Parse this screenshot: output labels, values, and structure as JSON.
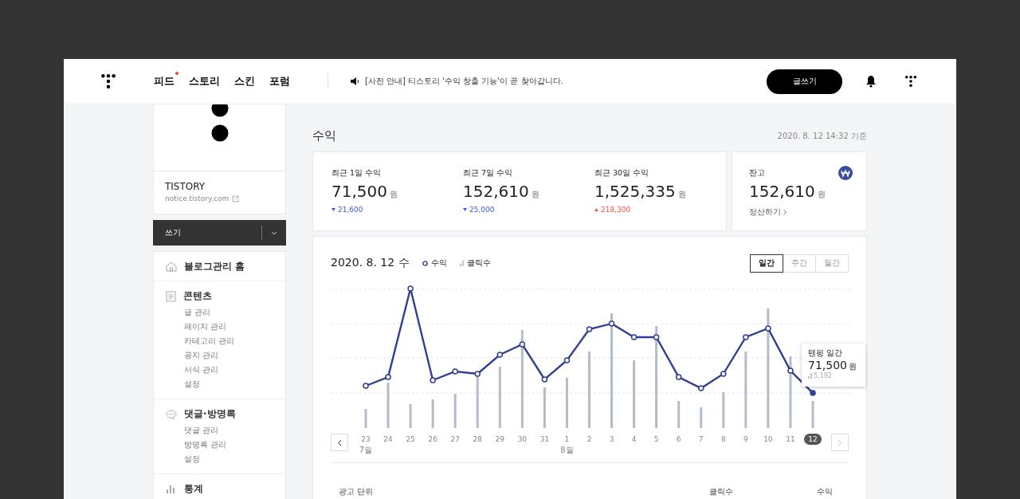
{
  "header": {
    "nav": [
      {
        "label": "피드",
        "new": true
      },
      {
        "label": "스토리",
        "new": false
      },
      {
        "label": "스킨",
        "new": false
      },
      {
        "label": "포럼",
        "new": false
      }
    ],
    "notice": "[사전 안내] 티스토리 '수익 창출 기능'이 곧 찾아갑니다.",
    "write_button": "글쓰기"
  },
  "sidebar": {
    "blog_name": "TISTORY",
    "blog_url": "notice.tistory.com",
    "write": "쓰기",
    "menu": [
      {
        "kind": "home",
        "label": "블로그관리 홈"
      },
      {
        "kind": "document",
        "label": "콘텐츠",
        "children": [
          {
            "label": "글 관리"
          },
          {
            "label": "페이지 관리"
          },
          {
            "label": "카테고리 관리"
          },
          {
            "label": "공지 관리"
          },
          {
            "label": "서식 관리"
          },
          {
            "label": "설정"
          }
        ]
      },
      {
        "kind": "comment",
        "label": "댓글·방명록",
        "children": [
          {
            "label": "댓글 관리"
          },
          {
            "label": "방명록 관리"
          },
          {
            "label": "설정"
          }
        ]
      },
      {
        "kind": "stats",
        "label": "통계"
      }
    ]
  },
  "main": {
    "title": "수익",
    "timestamp": "2020. 8. 12 14:32 기준",
    "stats": [
      {
        "label": "최근 1일 수익",
        "value": "71,500",
        "unit": "원",
        "kind": "down",
        "change": "21,600"
      },
      {
        "label": "최근 7일 수익",
        "value": "152,610",
        "unit": "원",
        "kind": "down",
        "change": "25,000"
      },
      {
        "label": "최근 30일 수익",
        "value": "1,525,335",
        "unit": "원",
        "kind": "up",
        "change": "218,300"
      }
    ],
    "balance": {
      "label": "잔고",
      "value": "152,610",
      "unit": "원",
      "link": "정산하기"
    },
    "chart": {
      "title": "2020. 8. 12 수",
      "legend": [
        {
          "kind": "line",
          "label": "수익"
        },
        {
          "kind": "bar",
          "label": "클릭수"
        }
      ],
      "periods": [
        {
          "label": "일간",
          "selected": true
        },
        {
          "label": "주간",
          "selected": false
        },
        {
          "label": "월간",
          "selected": false
        }
      ],
      "x_labels": [
        {
          "label": "23",
          "month": "7월",
          "selected": false
        },
        {
          "label": "24",
          "selected": false
        },
        {
          "label": "25",
          "selected": false
        },
        {
          "label": "26",
          "selected": false
        },
        {
          "label": "27",
          "selected": false
        },
        {
          "label": "28",
          "selected": false
        },
        {
          "label": "29",
          "selected": false
        },
        {
          "label": "30",
          "selected": false
        },
        {
          "label": "31",
          "selected": false
        },
        {
          "label": "1",
          "month": "8월",
          "selected": false
        },
        {
          "label": "2",
          "selected": false
        },
        {
          "label": "3",
          "selected": false
        },
        {
          "label": "4",
          "selected": false
        },
        {
          "label": "5",
          "selected": false
        },
        {
          "label": "6",
          "selected": false
        },
        {
          "label": "7",
          "selected": false
        },
        {
          "label": "8",
          "selected": false
        },
        {
          "label": "9",
          "selected": false
        },
        {
          "label": "10",
          "selected": false
        },
        {
          "label": "11",
          "selected": false
        },
        {
          "label": "12",
          "selected": true
        }
      ],
      "tooltip": {
        "title": "텐핑 일간",
        "value": "71,500",
        "unit": "원",
        "clicks": "5,192"
      }
    },
    "table": {
      "columns": [
        "광고 단위",
        "클릭수",
        "수익"
      ]
    }
  }
}
